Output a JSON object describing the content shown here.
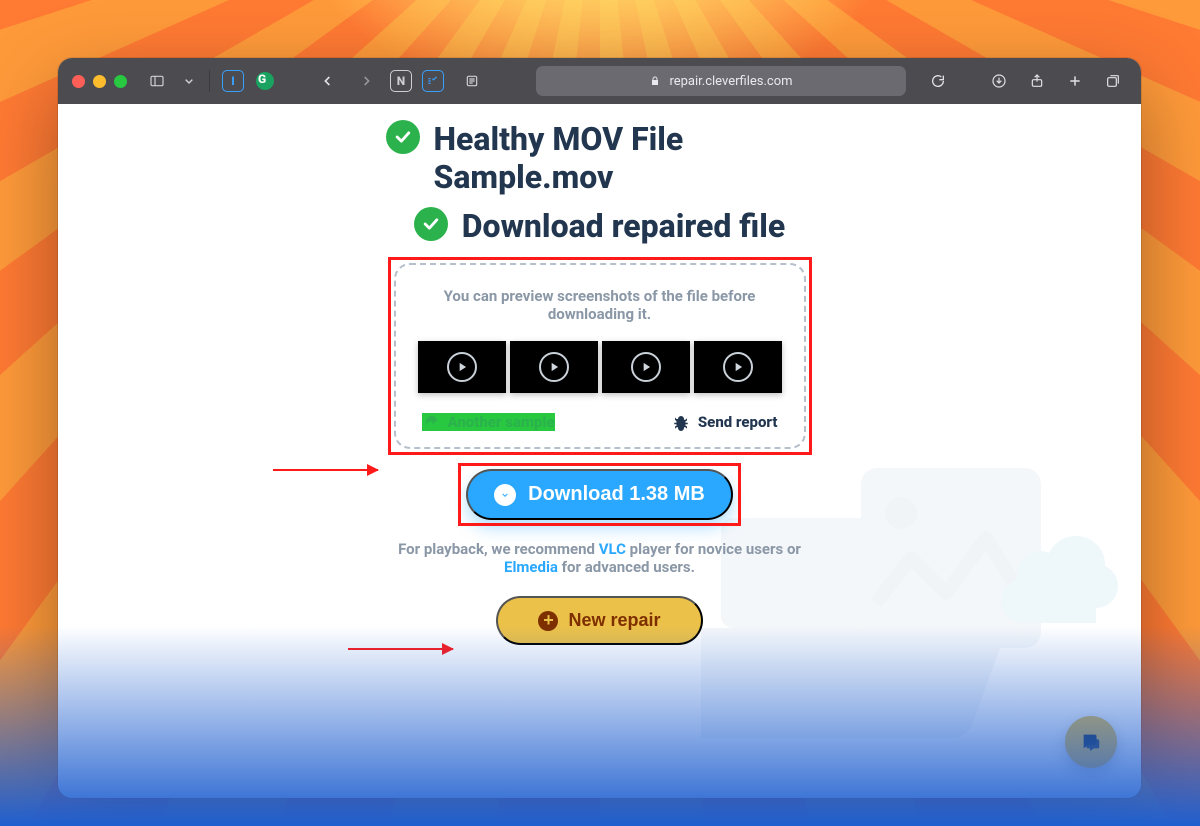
{
  "browser": {
    "address_display": "repair.cleverfiles.com"
  },
  "page": {
    "file_status_title": "Healthy MOV File Sample.mov",
    "download_status_title": "Download repaired file",
    "preview_hint": "You can preview screenshots of the file before downloading it.",
    "another_sample_label": "Another sample",
    "send_report_label": "Send report",
    "download_button_label": "Download 1.38 MB",
    "recommend_prefix": "For playback, we recommend ",
    "recommend_vlc": "VLC",
    "recommend_mid": " player for novice users or ",
    "recommend_elmedia": "Elmedia",
    "recommend_suffix": " for advanced users.",
    "new_repair_label": "New repair"
  }
}
